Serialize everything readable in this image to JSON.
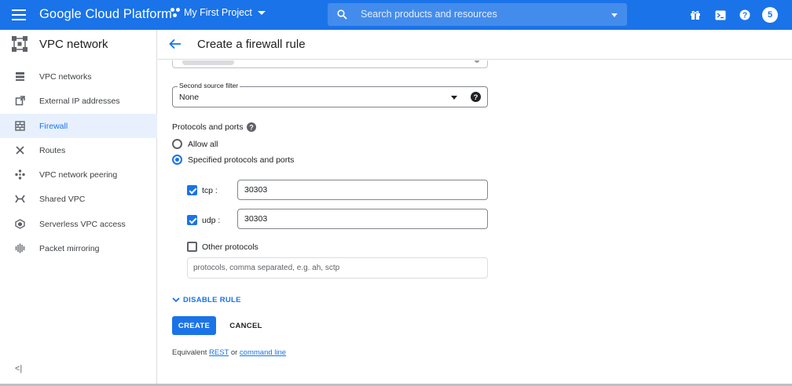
{
  "topbar": {
    "brand": "Google Cloud Platform",
    "project": "My First Project",
    "search_placeholder": "Search products and resources",
    "avatar_initial": "5"
  },
  "sidebar": {
    "title": "VPC network",
    "items": [
      {
        "label": "VPC networks",
        "icon": "vpc-networks-icon",
        "active": false
      },
      {
        "label": "External IP addresses",
        "icon": "external-ip-icon",
        "active": false
      },
      {
        "label": "Firewall",
        "icon": "firewall-icon",
        "active": true
      },
      {
        "label": "Routes",
        "icon": "routes-icon",
        "active": false
      },
      {
        "label": "VPC network peering",
        "icon": "peering-icon",
        "active": false
      },
      {
        "label": "Shared VPC",
        "icon": "shared-vpc-icon",
        "active": false
      },
      {
        "label": "Serverless VPC access",
        "icon": "serverless-icon",
        "active": false
      },
      {
        "label": "Packet mirroring",
        "icon": "packet-mirroring-icon",
        "active": false
      }
    ],
    "collapse_label": "<|"
  },
  "page": {
    "title": "Create a firewall rule"
  },
  "form": {
    "second_source_filter": {
      "label": "Second source filter",
      "value": "None"
    },
    "protocols_title": "Protocols and ports",
    "radio_allow_all": "Allow all",
    "radio_specified": "Specified protocols and ports",
    "tcp": {
      "label": "tcp :",
      "checked": true,
      "value": "30303"
    },
    "udp": {
      "label": "udp :",
      "checked": true,
      "value": "30303"
    },
    "other": {
      "label": "Other protocols",
      "checked": false,
      "placeholder": "protocols, comma separated, e.g. ah, sctp"
    },
    "disable_rule": "DISABLE RULE",
    "create_label": "CREATE",
    "cancel_label": "CANCEL",
    "equiv_prefix": "Equivalent",
    "equiv_rest": "REST",
    "equiv_or": "or",
    "equiv_cmd": "command line"
  },
  "colors": {
    "accent": "#1a73e8",
    "active_bg": "#e8f0fe"
  }
}
